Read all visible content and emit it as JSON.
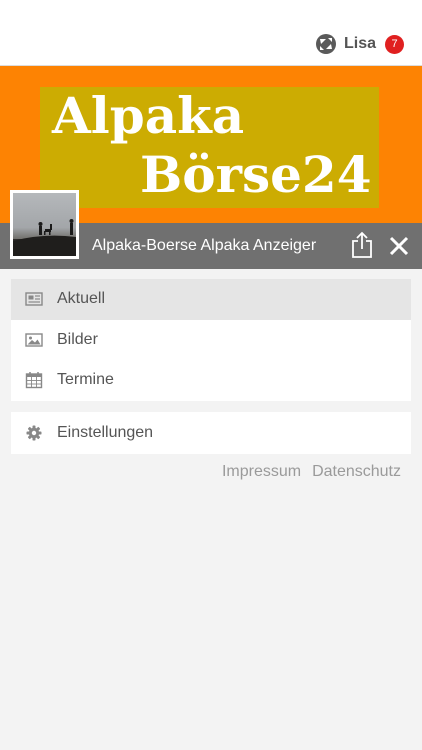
{
  "header": {
    "user_name": "Lisa",
    "notification_count": "7",
    "logo_icon": "app-logo-icon"
  },
  "banner": {
    "line1": "Alpaka",
    "line2": "Börse24"
  },
  "profile": {
    "title": "Alpaka-Boerse Alpaka Anzeiger",
    "share_icon": "share-icon",
    "close_icon": "close-icon"
  },
  "menu": {
    "items": [
      {
        "label": "Aktuell",
        "icon": "newspaper-icon",
        "active": true
      },
      {
        "label": "Bilder",
        "icon": "image-icon",
        "active": false
      },
      {
        "label": "Termine",
        "icon": "calendar-icon",
        "active": false
      }
    ],
    "settings_label": "Einstellungen",
    "settings_icon": "gear-icon"
  },
  "footer": {
    "impressum": "Impressum",
    "datenschutz": "Datenschutz"
  },
  "colors": {
    "hero_orange": "#fd8303",
    "banner_olive": "#ccac02",
    "titlebar_gray": "#707070",
    "badge_red": "#e02020"
  }
}
